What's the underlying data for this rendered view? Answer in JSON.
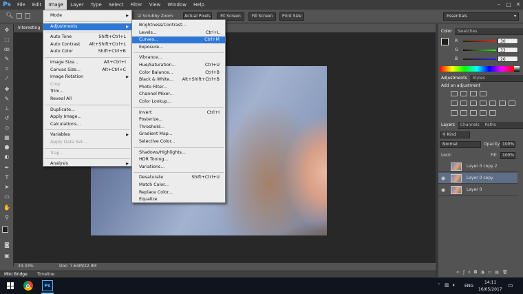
{
  "menubar": {
    "logo": "Ps",
    "items": [
      "File",
      "Edit",
      "Image",
      "Layer",
      "Type",
      "Select",
      "Filter",
      "View",
      "Window",
      "Help"
    ],
    "active_index": 2
  },
  "window_controls": [
    "–",
    "□",
    "✕"
  ],
  "options_bar": {
    "scrubby_zoom": "Scrubby Zoom",
    "actual_pixels": "Actual Pixels",
    "fit_screen": "Fit Screen",
    "fill_screen": "Fill Screen",
    "print_size": "Print Size",
    "workspace": "Essentials"
  },
  "doc_tab": {
    "title": "Interesting"
  },
  "image_menu": {
    "items": [
      {
        "label": "Mode",
        "shortcut": "",
        "submenu": true,
        "disabled": false
      },
      {
        "sep": true
      },
      {
        "label": "Adjustments",
        "shortcut": "",
        "submenu": true,
        "disabled": false,
        "highlight": true
      },
      {
        "sep": true
      },
      {
        "label": "Auto Tone",
        "shortcut": "Shift+Ctrl+L",
        "disabled": false
      },
      {
        "label": "Auto Contrast",
        "shortcut": "Alt+Shift+Ctrl+L",
        "disabled": false
      },
      {
        "label": "Auto Color",
        "shortcut": "Shift+Ctrl+B",
        "disabled": false
      },
      {
        "sep": true
      },
      {
        "label": "Image Size...",
        "shortcut": "Alt+Ctrl+I",
        "disabled": false
      },
      {
        "label": "Canvas Size...",
        "shortcut": "Alt+Ctrl+C",
        "disabled": false
      },
      {
        "label": "Image Rotation",
        "shortcut": "",
        "submenu": true,
        "disabled": false
      },
      {
        "label": "Crop",
        "shortcut": "",
        "disabled": true
      },
      {
        "label": "Trim...",
        "shortcut": "",
        "disabled": false
      },
      {
        "label": "Reveal All",
        "shortcut": "",
        "disabled": false
      },
      {
        "sep": true
      },
      {
        "label": "Duplicate...",
        "shortcut": "",
        "disabled": false
      },
      {
        "label": "Apply Image...",
        "shortcut": "",
        "disabled": false
      },
      {
        "label": "Calculations...",
        "shortcut": "",
        "disabled": false
      },
      {
        "sep": true
      },
      {
        "label": "Variables",
        "shortcut": "",
        "submenu": true,
        "disabled": false
      },
      {
        "label": "Apply Data Set...",
        "shortcut": "",
        "disabled": true
      },
      {
        "sep": true
      },
      {
        "label": "Trap...",
        "shortcut": "",
        "disabled": true
      },
      {
        "sep": true
      },
      {
        "label": "Analysis",
        "shortcut": "",
        "submenu": true,
        "disabled": false
      }
    ]
  },
  "adjustments_menu": {
    "items": [
      {
        "label": "Brightness/Contrast...",
        "shortcut": ""
      },
      {
        "label": "Levels...",
        "shortcut": "Ctrl+L"
      },
      {
        "label": "Curves...",
        "shortcut": "Ctrl+M",
        "highlight": true
      },
      {
        "label": "Exposure...",
        "shortcut": ""
      },
      {
        "sep": true
      },
      {
        "label": "Vibrance...",
        "shortcut": ""
      },
      {
        "label": "Hue/Saturation...",
        "shortcut": "Ctrl+U"
      },
      {
        "label": "Color Balance...",
        "shortcut": "Ctrl+B"
      },
      {
        "label": "Black & White...",
        "shortcut": "Alt+Shift+Ctrl+B"
      },
      {
        "label": "Photo Filter...",
        "shortcut": ""
      },
      {
        "label": "Channel Mixer...",
        "shortcut": ""
      },
      {
        "label": "Color Lookup...",
        "shortcut": ""
      },
      {
        "sep": true
      },
      {
        "label": "Invert",
        "shortcut": "Ctrl+I"
      },
      {
        "label": "Posterize...",
        "shortcut": ""
      },
      {
        "label": "Threshold...",
        "shortcut": ""
      },
      {
        "label": "Gradient Map...",
        "shortcut": ""
      },
      {
        "label": "Selective Color...",
        "shortcut": ""
      },
      {
        "sep": true
      },
      {
        "label": "Shadows/Highlights...",
        "shortcut": ""
      },
      {
        "label": "HDR Toning...",
        "shortcut": ""
      },
      {
        "label": "Variations...",
        "shortcut": ""
      },
      {
        "sep": true
      },
      {
        "label": "Desaturate",
        "shortcut": "Shift+Ctrl+U"
      },
      {
        "label": "Match Color...",
        "shortcut": ""
      },
      {
        "label": "Replace Color...",
        "shortcut": ""
      },
      {
        "label": "Equalize",
        "shortcut": ""
      }
    ]
  },
  "color_panel": {
    "tabs": [
      "Color",
      "Swatches"
    ],
    "r_label": "R",
    "g_label": "G",
    "b_label": "B",
    "r": "30",
    "g": "33",
    "b": "26"
  },
  "adjustments_panel": {
    "tabs": [
      "Adjustments",
      "Styles"
    ],
    "heading": "Add an adjustment"
  },
  "layers_panel": {
    "tabs": [
      "Layers",
      "Channels",
      "Paths"
    ],
    "kind": "Kind",
    "blend": "Normal",
    "opacity_label": "Opacity:",
    "opacity": "100%",
    "lock_label": "Lock:",
    "fill_label": "Fill:",
    "fill": "100%",
    "layers": [
      {
        "name": "Layer 0 copy 2",
        "visible": false,
        "selected": false
      },
      {
        "name": "Layer 0 copy",
        "visible": true,
        "selected": true
      },
      {
        "name": "Layer 0",
        "visible": true,
        "selected": false
      }
    ]
  },
  "status": {
    "zoom": "33.33%",
    "doc": "Doc: 7.64M/22.9M"
  },
  "bottom_tabs": [
    "Mini Bridge",
    "Timeline"
  ],
  "taskbar": {
    "language": "ENG",
    "time": "14:11",
    "date": "16/05/2017"
  },
  "colors": {
    "menu_highlight": "#2f77d5",
    "ps_blue": "#5ab1ff",
    "selected_layer": "#5e6e86"
  }
}
